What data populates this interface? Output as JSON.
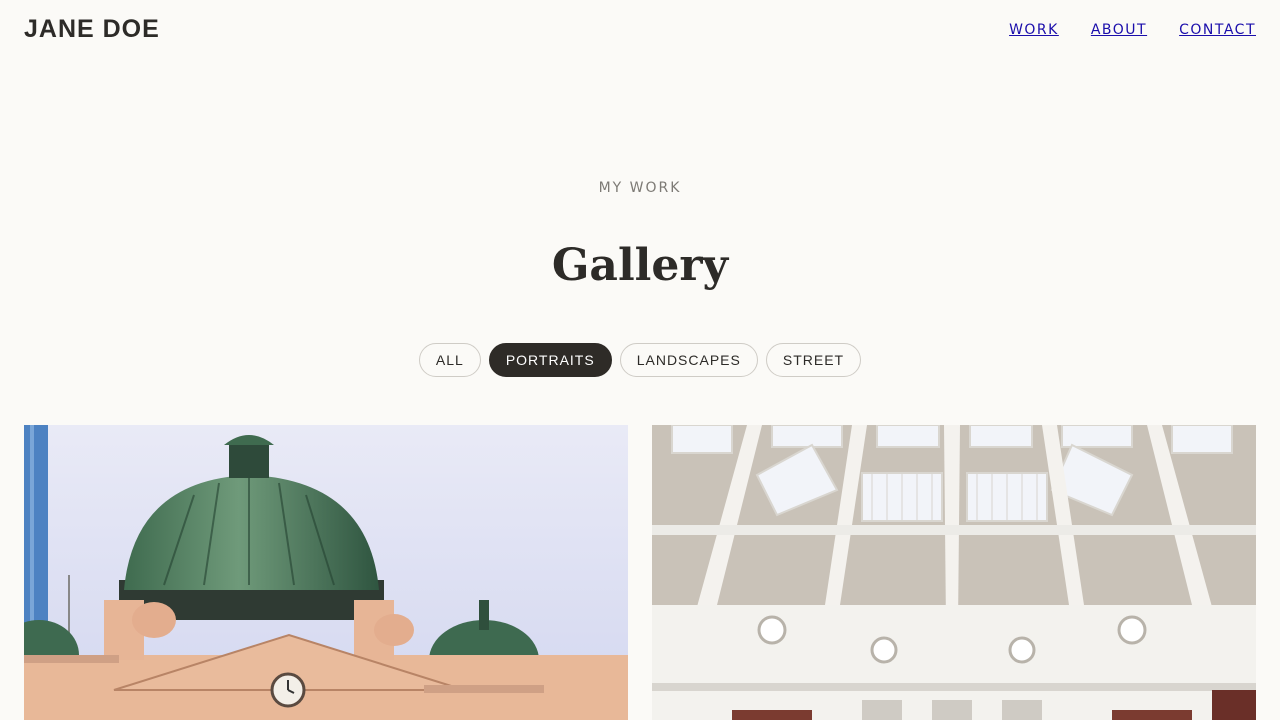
{
  "header": {
    "logo": "JANE DOE",
    "nav": [
      "WORK",
      "ABOUT",
      "CONTACT"
    ]
  },
  "hero": {
    "eyebrow": "MY WORK",
    "title": "Gallery"
  },
  "filters": {
    "items": [
      "ALL",
      "PORTRAITS",
      "LANDSCAPES",
      "STREET"
    ],
    "active": "PORTRAITS"
  },
  "gallery": {
    "photos": [
      {
        "subject": "domed-station-building-photo"
      },
      {
        "subject": "library-dome-interior-photo"
      }
    ]
  },
  "colors": {
    "background": "#fbfaf7",
    "text": "#2d2b28",
    "muted": "#7d7a75",
    "link": "#1a0dab",
    "chip_active": "#2e2b27"
  }
}
